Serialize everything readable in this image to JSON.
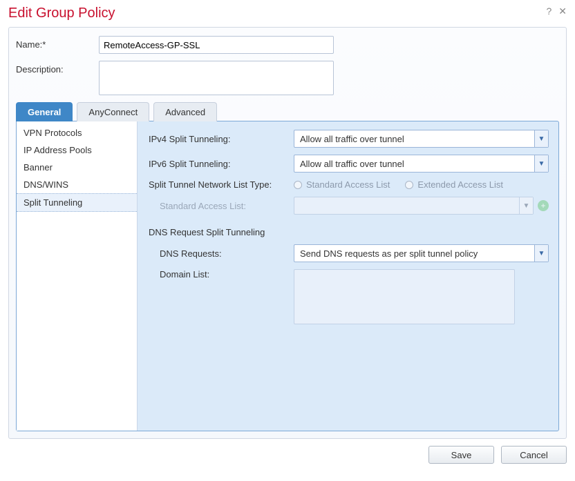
{
  "title": "Edit Group Policy",
  "form": {
    "name_label": "Name:*",
    "name_value": "RemoteAccess-GP-SSL",
    "description_label": "Description:",
    "description_value": ""
  },
  "tabs": {
    "general": "General",
    "anyconnect": "AnyConnect",
    "advanced": "Advanced"
  },
  "sidebar": {
    "items": [
      "VPN Protocols",
      "IP Address Pools",
      "Banner",
      "DNS/WINS",
      "Split Tunneling"
    ],
    "selected_index": 4
  },
  "content": {
    "ipv4_label": "IPv4 Split Tunneling:",
    "ipv4_value": "Allow all traffic over tunnel",
    "ipv6_label": "IPv6 Split Tunneling:",
    "ipv6_value": "Allow all traffic over tunnel",
    "network_type_label": "Split Tunnel Network List Type:",
    "radio_standard": "Standard Access List",
    "radio_extended": "Extended Access List",
    "standard_acl_label": "Standard Access List:",
    "standard_acl_value": "",
    "dns_section": "DNS Request Split Tunneling",
    "dns_requests_label": "DNS Requests:",
    "dns_requests_value": "Send DNS requests as per split tunnel policy",
    "domain_list_label": "Domain List:"
  },
  "buttons": {
    "save": "Save",
    "cancel": "Cancel"
  }
}
